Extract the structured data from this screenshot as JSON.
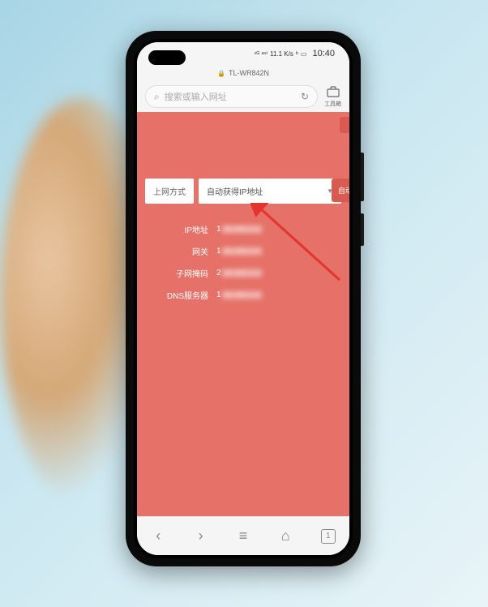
{
  "status": {
    "signal": "⁴ᴳ ᵃⁿᵗ",
    "carrier": "ₐₗₗ",
    "network": "11.1 K/s",
    "bt_icon": "ᵇ",
    "battery_icon": "▭",
    "time": "10:40"
  },
  "url_bar": {
    "lock": "🔒",
    "title": "TL-WR842N"
  },
  "search": {
    "icon": "⌕",
    "placeholder": "搜索或输入网址",
    "refresh": "↻"
  },
  "toolbox": {
    "icon": "🧰",
    "label": "工具箱"
  },
  "form": {
    "method_label": "上网方式",
    "method_value": "自动获得IP地址",
    "auto_btn": "自动",
    "rows": [
      {
        "label": "IP地址",
        "value": "1",
        "blur": "xx.xxx.x.x"
      },
      {
        "label": "网关",
        "value": "1",
        "blur": "xx.xxx.x.x"
      },
      {
        "label": "子网掩码",
        "value": "2",
        "blur": "xx.xxx.x.x"
      },
      {
        "label": "DNS服务器",
        "value": "1",
        "blur": "xx.xxx.x.x"
      }
    ]
  },
  "nav": {
    "back": "‹",
    "forward": "›",
    "menu": "≡",
    "home": "⌂",
    "tabs_count": "1"
  }
}
